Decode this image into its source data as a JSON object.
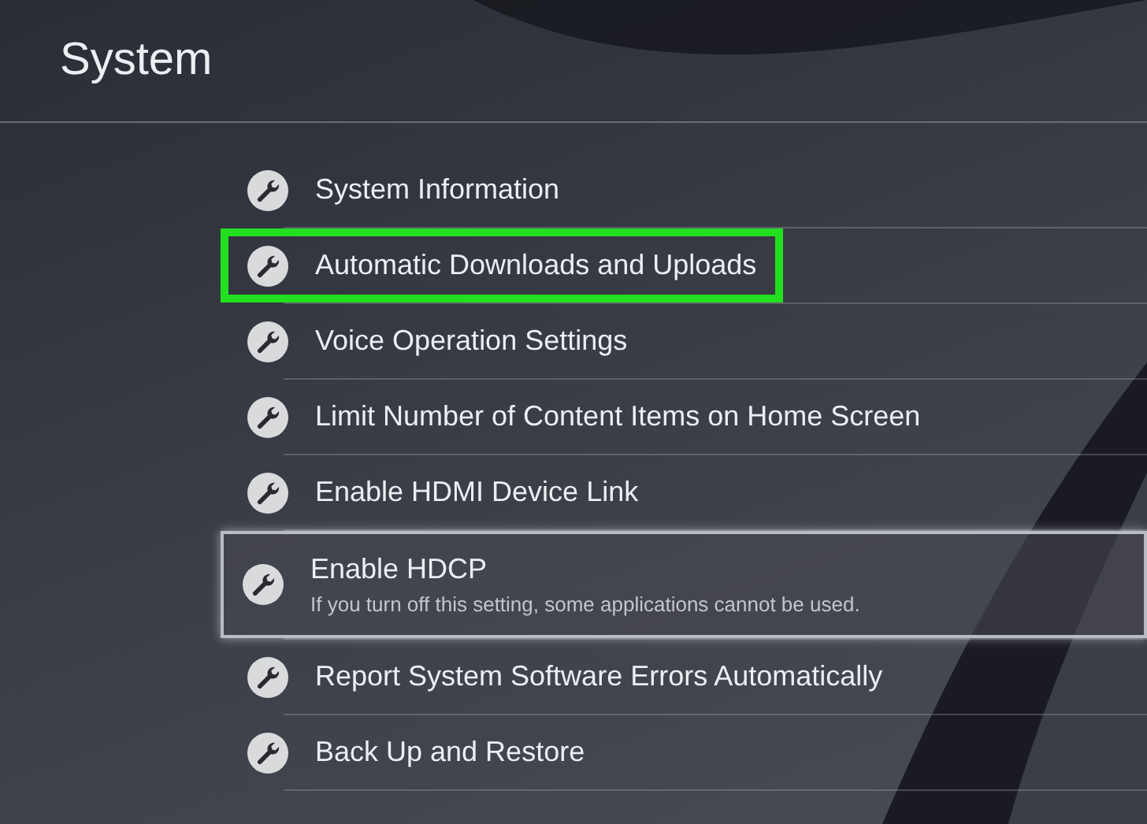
{
  "screen": {
    "title": "System"
  },
  "menu_items": [
    {
      "label": "System Information",
      "selected": false,
      "highlighted": false
    },
    {
      "label": "Automatic Downloads and Uploads",
      "selected": false,
      "highlighted": true
    },
    {
      "label": "Voice Operation Settings",
      "selected": false,
      "highlighted": false
    },
    {
      "label": "Limit Number of Content Items on Home Screen",
      "selected": false,
      "highlighted": false
    },
    {
      "label": "Enable HDMI Device Link",
      "selected": false,
      "highlighted": false
    },
    {
      "label": "Enable HDCP",
      "description": "If you turn off this setting, some applications cannot be used.",
      "selected": true,
      "highlighted": false
    },
    {
      "label": "Report System Software Errors Automatically",
      "selected": false,
      "highlighted": false
    },
    {
      "label": "Back Up and Restore",
      "selected": false,
      "highlighted": false
    }
  ]
}
